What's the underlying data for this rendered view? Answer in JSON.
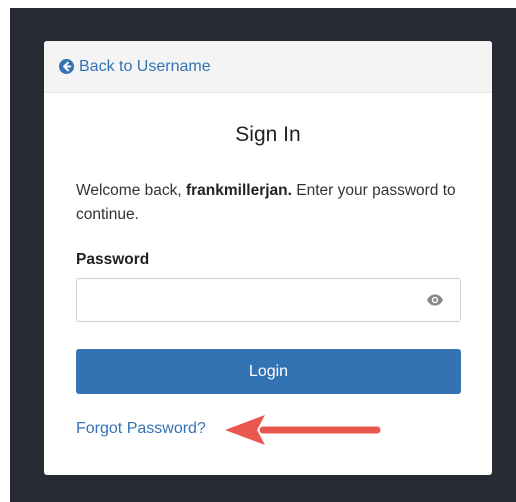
{
  "header": {
    "back_label": "Back to Username"
  },
  "form": {
    "title": "Sign In",
    "welcome_prefix": "Welcome back, ",
    "username": "frankmillerjan.",
    "welcome_suffix": " Enter your password to continue.",
    "password_label": "Password",
    "password_value": "",
    "login_label": "Login",
    "forgot_label": "Forgot Password?"
  },
  "icons": {
    "back": "circle-arrow-left-icon",
    "show_password": "eye-icon",
    "annotation": "red-arrow-annotation"
  },
  "colors": {
    "accent": "#3373b4",
    "background": "#262b33",
    "annotation": "#e8584f"
  }
}
